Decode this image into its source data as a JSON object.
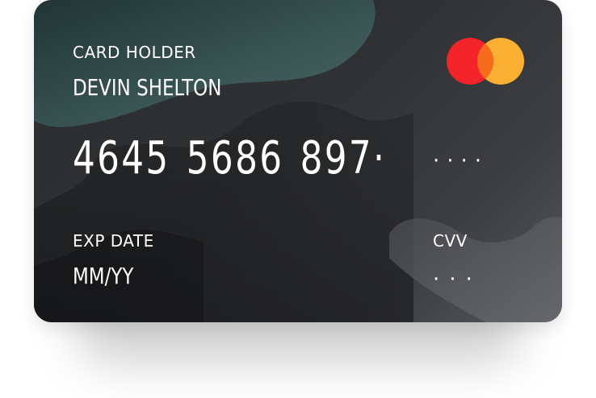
{
  "card": {
    "holder_label": "CARD HOLDER",
    "holder_name": "DEVIN SHELTON",
    "number_groups": [
      "4645",
      "5686",
      "897·"
    ],
    "number_masked": "····",
    "exp_label": "EXP DATE",
    "exp_value": "MM/YY",
    "cvv_label": "CVV",
    "cvv_value": "···"
  },
  "brand": {
    "logo_icon": "mastercard-logo",
    "colors": {
      "left_circle": "#f2242a",
      "right_circle": "#fbb033",
      "overlap": "#f76b1c"
    }
  },
  "colors": {
    "card_dark": "#2a2d2f",
    "card_light": "#55585b",
    "accent_teal": "#3f5d5b",
    "text": "#ffffff"
  }
}
